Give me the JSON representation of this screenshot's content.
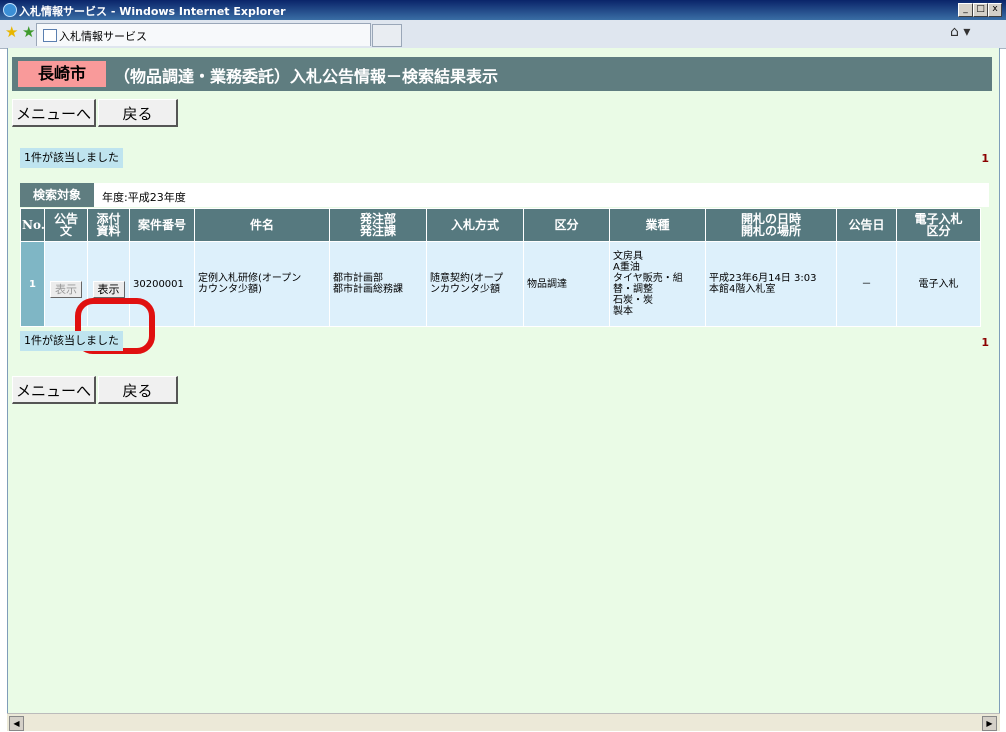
{
  "window": {
    "title": "入札情報サービス - Windows Internet Explorer",
    "minimize": "_",
    "maximize": "□",
    "close": "x"
  },
  "tab": {
    "label": "入札情報サービス"
  },
  "header": {
    "city": "長崎市",
    "title": "（物品調達・業務委託）入札公告情報－検索結果表示"
  },
  "nav": {
    "menu_label": "メニューへ",
    "back_label": "戻る"
  },
  "result": {
    "count_text": "1件が該当しました",
    "count_right": "1"
  },
  "search": {
    "label": "検索対象",
    "value": "年度:平成23年度"
  },
  "table": {
    "headers": [
      "No.",
      "公告\n文",
      "添付\n資料",
      "案件番号",
      "件名",
      "発注部\n発注課",
      "入札方式",
      "区分",
      "業種",
      "開札の日時\n開札の場所",
      "公告日",
      "電子入札\n区分"
    ],
    "rows": [
      {
        "no": "1",
        "notice_button": "表示",
        "attach_button": "表示",
        "case_no": "30200001",
        "subject": "定例入札研修(オープン\nカウンタ少額)",
        "department": "都市計画部\n都市計画総務課",
        "method": "随意契約(オープ\nンカウンタ少額",
        "category": "物品調達",
        "industry": "文房具\nA重油\nタイヤ販売・組\n替・調整\n石炭・炭\n製本",
        "opening": "平成23年6月14日 3:03\n本館4階入札室",
        "notice_date": "－",
        "e_bid": "電子入札"
      }
    ]
  },
  "colors": {
    "header_bg": "#5f7d80",
    "content_bg": "#eafbe6",
    "city_bg": "#f99a9a",
    "annotation": "#e01010"
  }
}
